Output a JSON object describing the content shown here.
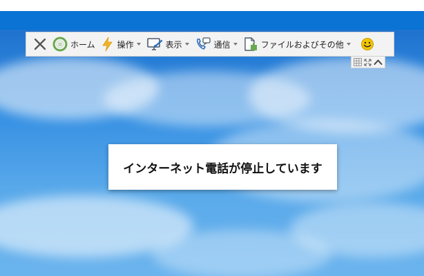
{
  "toolbar": {
    "home_label": "ホーム",
    "operations_label": "操作",
    "view_label": "表示",
    "communication_label": "通信",
    "files_label": "ファイルおよびその他"
  },
  "message": {
    "text": "インターネット電話が停止しています"
  },
  "colors": {
    "title_bar": "#0a73d4",
    "toolbar_bg": "#f3f3f3",
    "home_icon": "#6aa84f",
    "operations_icon": "#f0b429",
    "smiley": "#f2c500"
  }
}
